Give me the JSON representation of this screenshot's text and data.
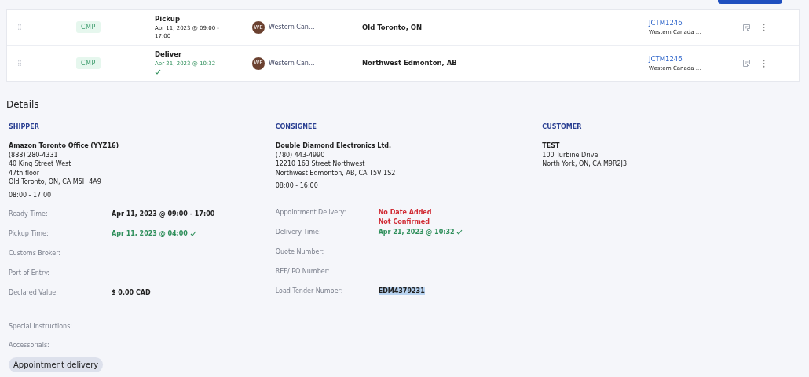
{
  "stops": [
    {
      "status": "CMP",
      "type": "Pickup",
      "time": "Apr 11, 2023 @ 09:00 - 17:00",
      "verified": false,
      "carrier_initials": "WE",
      "carrier": "Western Can...",
      "location": "Old Toronto, ON",
      "reference": "JCTM1246",
      "reference_sub": "Western Canada ..."
    },
    {
      "status": "CMP",
      "type": "Deliver",
      "time": "Apr 21, 2023 @ 10:32",
      "verified": true,
      "carrier_initials": "WE",
      "carrier": "Western Can...",
      "location": "Northwest Edmonton, AB",
      "reference": "JCTM1246",
      "reference_sub": "Western Canada ..."
    }
  ],
  "details": {
    "title": "Details",
    "parties": [
      {
        "heading": "SHIPPER",
        "name": "Amazon Toronto Office (YYZ16)",
        "lines": [
          "(888) 280-4331",
          "40 King Street West",
          "47th floor",
          "Old Toronto, ON, CA M5H 4A9"
        ],
        "hours": "08:00 - 17:00",
        "fields": [
          {
            "label": "Ready Time:",
            "kind": "plain",
            "values": [
              "Apr 11, 2023 @ 09:00 - 17:00"
            ],
            "verified": false
          },
          {
            "label": "Pickup Time:",
            "kind": "success",
            "values": [
              "Apr 11, 2023 @ 04:00"
            ],
            "verified": true
          },
          {
            "label": "Customs Broker:",
            "kind": "plain"
          },
          {
            "label": "Port of Entry:",
            "kind": "plain"
          },
          {
            "label": "Declared Value:",
            "kind": "plain",
            "values": [
              "$ 0.00 CAD"
            ],
            "verified": false
          }
        ]
      },
      {
        "heading": "CONSIGNEE",
        "name": "Double Diamond Electronics Ltd.",
        "lines": [
          "(780) 443-4990",
          "12210 163 Street Northwest",
          "Northwest Edmonton, AB, CA T5V 1S2"
        ],
        "hours": "08:00 - 16:00",
        "fields": [
          {
            "label": "Appointment Delivery:",
            "kind": "danger",
            "values": [
              "No Date Added",
              "Not Confirmed"
            ],
            "verified": false
          },
          {
            "label": "Delivery Time:",
            "kind": "success",
            "values": [
              "Apr 21, 2023 @ 10:32"
            ],
            "verified": true
          },
          {
            "label": "Quote Number:",
            "kind": "plain"
          },
          {
            "label": "REF/ PO Number:",
            "kind": "plain"
          },
          {
            "label": "Load Tender Number:",
            "kind": "highlighted",
            "values": [
              "EDM4379231"
            ],
            "verified": false
          }
        ]
      },
      {
        "heading": "CUSTOMER",
        "name": "TEST",
        "lines": [
          "100 Turbine Drive",
          "North York, ON, CA M9R2J3"
        ]
      }
    ],
    "special_instructions_label": "Special Instructions:",
    "accessorials_label": "Accessorials:",
    "accessorials": [
      "Appointment delivery"
    ]
  }
}
